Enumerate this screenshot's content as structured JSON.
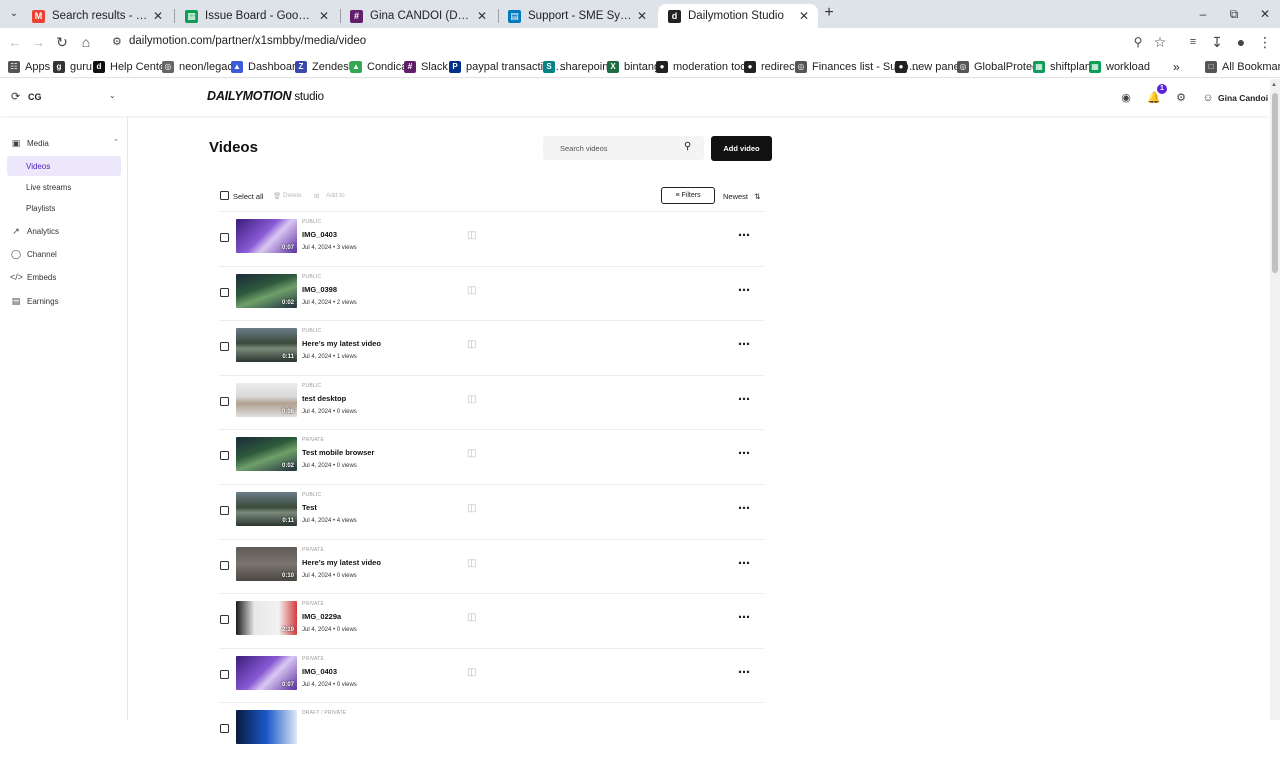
{
  "browser": {
    "tabs": [
      {
        "title": "Search results - gina.candoi@t…",
        "favicon_color": "#ea4335",
        "favicon": "M",
        "active": false
      },
      {
        "title": "Issue Board - Google Sheets",
        "favicon_color": "#0f9d58",
        "favicon": "▦",
        "active": false
      },
      {
        "title": "Gina CANDOI (DM) - dailymotio…",
        "favicon_color": "#611f69",
        "favicon": "#",
        "active": false
      },
      {
        "title": "Support - SME Sync | Trello",
        "favicon_color": "#0079bf",
        "favicon": "▤",
        "active": false
      },
      {
        "title": "Dailymotion Studio",
        "favicon_color": "#222222",
        "favicon": "d",
        "active": true
      }
    ],
    "url": "dailymotion.com/partner/x1smbby/media/video",
    "bookmarks": [
      {
        "label": "Apps",
        "icon_color": "#555555"
      },
      {
        "label": "guru",
        "icon_color": "#333333"
      },
      {
        "label": "Help Center",
        "icon_color": "#111111"
      },
      {
        "label": "neon/legacy",
        "icon_color": "#666666"
      },
      {
        "label": "Dashboard",
        "icon_color": "#3b5bdb"
      },
      {
        "label": "Zendesk",
        "icon_color": "#3949ab"
      },
      {
        "label": "Condica",
        "icon_color": "#34a853"
      },
      {
        "label": "Slack",
        "icon_color": "#611f69"
      },
      {
        "label": "paypal transaction…",
        "icon_color": "#003087"
      },
      {
        "label": "sharepoint",
        "icon_color": "#038387"
      },
      {
        "label": "bintang",
        "icon_color": "#1d6f42"
      },
      {
        "label": "moderation tool",
        "icon_color": "#222222"
      },
      {
        "label": "redirect",
        "icon_color": "#222222"
      },
      {
        "label": "Finances list - Supp…",
        "icon_color": "#555555"
      },
      {
        "label": "new panel",
        "icon_color": "#222222"
      },
      {
        "label": "GlobalProtect",
        "icon_color": "#555555"
      },
      {
        "label": "shiftplan",
        "icon_color": "#0f9d58"
      },
      {
        "label": "workload",
        "icon_color": "#0f9d58"
      },
      {
        "label": "All Bookmarks",
        "icon_color": "#555555"
      }
    ]
  },
  "app": {
    "workspace": "CG",
    "logo": "DAILYMOTION",
    "logo_suffix": "studio",
    "notification_count": "1",
    "user_name": "Gina Candoi",
    "accent": "#5b23d8"
  },
  "sidebar": {
    "media": "Media",
    "videos": "Videos",
    "live_streams": "Live streams",
    "playlists": "Playlists",
    "analytics": "Analytics",
    "channel": "Channel",
    "embeds": "Embeds",
    "earnings": "Earnings"
  },
  "main": {
    "title": "Videos",
    "search_placeholder": "Search videos",
    "add_video": "Add video",
    "select_all": "Select all",
    "delete": "Delete",
    "add_to": "Add to",
    "filters": "Filters",
    "sort": "Newest"
  },
  "videos": [
    {
      "status": "PUBLIC",
      "title": "IMG_0403",
      "meta": "Jul 4, 2024 • 3 views",
      "duration": "0:07",
      "thumb": "purple"
    },
    {
      "status": "PUBLIC",
      "title": "IMG_0398",
      "meta": "Jul 4, 2024 • 2 views",
      "duration": "0:02",
      "thumb": "green"
    },
    {
      "status": "PUBLIC",
      "title": "Here’s my latest video",
      "meta": "Jul 4, 2024 • 1 views",
      "duration": "0:11",
      "thumb": "street"
    },
    {
      "status": "PUBLIC",
      "title": "test desktop",
      "meta": "Jul 4, 2024 • 0 views",
      "duration": "0:06",
      "thumb": "desk"
    },
    {
      "status": "PRIVATE",
      "title": "Test mobile browser",
      "meta": "Jul 4, 2024 • 0 views",
      "duration": "0:02",
      "thumb": "green"
    },
    {
      "status": "PUBLIC",
      "title": "Test",
      "meta": "Jul 4, 2024 • 4 views",
      "duration": "0:11",
      "thumb": "street"
    },
    {
      "status": "PRIVATE",
      "title": "Here’s my latest video",
      "meta": "Jul 4, 2024 • 0 views",
      "duration": "0:10",
      "thumb": "grey"
    },
    {
      "status": "PRIVATE",
      "title": "IMG_0229a",
      "meta": "Jul 4, 2024 • 0 views",
      "duration": "2:19",
      "thumb": "red"
    },
    {
      "status": "PRIVATE",
      "title": "IMG_0403",
      "meta": "Jul 4, 2024 • 0 views",
      "duration": "0:07",
      "thumb": "purple"
    },
    {
      "status": "DRAFT / PRIVATE",
      "title": "",
      "meta": "",
      "duration": "",
      "thumb": "blue"
    }
  ]
}
